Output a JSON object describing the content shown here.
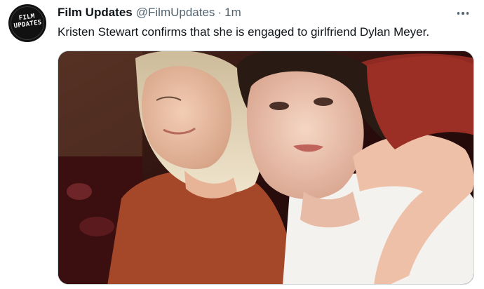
{
  "tweet": {
    "avatar_text": [
      "FILM",
      "UPDATES"
    ],
    "display_name": "Film Updates",
    "handle": "@FilmUpdates",
    "separator": "·",
    "time": "1m",
    "text": "Kristen Stewart confirms that she is engaged to girlfriend Dylan Meyer.",
    "more_icon": "more-horizontal-icon"
  },
  "colors": {
    "text_primary": "#0f1419",
    "text_secondary": "#536471",
    "media_border": "#cfd9de"
  }
}
